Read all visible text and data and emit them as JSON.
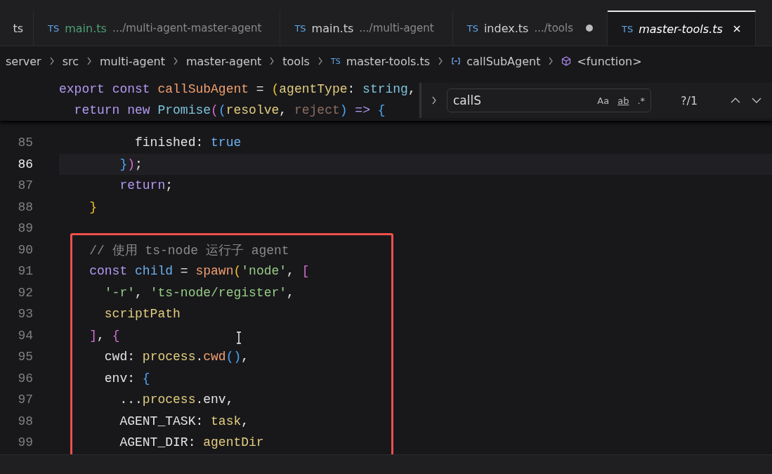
{
  "tabs": [
    {
      "label": "ts",
      "selected": false,
      "modified": false,
      "preview": false,
      "color": "#cfcfcf"
    },
    {
      "icon_text": "TS",
      "label": "main.ts",
      "description": ".../multi-agent-master-agent",
      "selected": false,
      "modified": false,
      "preview": false,
      "color": "#4f9e74"
    },
    {
      "icon_text": "TS",
      "label": "main.ts",
      "description": ".../multi-agent",
      "selected": false,
      "modified": false,
      "preview": false,
      "color": "#cfcfcf"
    },
    {
      "icon_text": "TS",
      "label": "index.ts",
      "description": ".../tools",
      "selected": false,
      "modified": true,
      "preview": false,
      "color": "#cfcfcf"
    },
    {
      "icon_text": "TS",
      "label": "master-tools.ts",
      "selected": true,
      "modified": false,
      "preview": true,
      "color": "#ffffff"
    }
  ],
  "breadcrumb": [
    {
      "kind": "folder",
      "label": "server"
    },
    {
      "kind": "folder",
      "label": "src"
    },
    {
      "kind": "folder",
      "label": "multi-agent"
    },
    {
      "kind": "folder",
      "label": "master-agent"
    },
    {
      "kind": "folder",
      "label": "tools"
    },
    {
      "kind": "file",
      "icon_text": "TS",
      "label": "master-tools.ts"
    },
    {
      "kind": "method",
      "label": "callSubAgent"
    },
    {
      "kind": "function",
      "label": "<function>"
    }
  ],
  "sticky_lines": [
    {
      "tokens": [
        {
          "text": "export ",
          "kind": "kw"
        },
        {
          "text": "const ",
          "kind": "kw"
        },
        {
          "text": "callSubAgent",
          "kind": "fn"
        },
        {
          "text": " = ",
          "kind": "plain"
        },
        {
          "text": "(",
          "kind": "b1"
        },
        {
          "text": "agentType",
          "kind": "param"
        },
        {
          "text": ": ",
          "kind": "plain"
        },
        {
          "text": "string",
          "kind": "type"
        },
        {
          "text": ",",
          "kind": "plain"
        }
      ]
    },
    {
      "tokens": [
        {
          "text": "  return ",
          "kind": "kw"
        },
        {
          "text": "new ",
          "kind": "kw"
        },
        {
          "text": "Promise",
          "kind": "type"
        },
        {
          "text": "(",
          "kind": "b2"
        },
        {
          "text": "(",
          "kind": "b3"
        },
        {
          "text": "resolve",
          "kind": "param"
        },
        {
          "text": ", ",
          "kind": "plain"
        },
        {
          "text": "reject",
          "kind": "unused"
        },
        {
          "text": ")",
          "kind": "b3"
        },
        {
          "text": " => ",
          "kind": "kw"
        },
        {
          "text": "{",
          "kind": "b3"
        }
      ]
    }
  ],
  "find": {
    "value": "callS",
    "options": [
      "Aa",
      "ab",
      ".*"
    ],
    "result": "?/1"
  },
  "lines": [
    {
      "number": "85",
      "current": false,
      "tokens": [
        {
          "text": "          finished",
          "kind": "plain"
        },
        {
          "text": ": ",
          "kind": "plain"
        },
        {
          "text": "true",
          "kind": "const"
        }
      ]
    },
    {
      "number": "86",
      "current": true,
      "tokens": [
        {
          "text": "        }",
          "kind": "b3"
        },
        {
          "text": ")",
          "kind": "b2"
        },
        {
          "text": ";",
          "kind": "plain"
        }
      ]
    },
    {
      "number": "87",
      "current": false,
      "tokens": [
        {
          "text": "        return",
          "kind": "kw"
        },
        {
          "text": ";",
          "kind": "plain"
        }
      ]
    },
    {
      "number": "88",
      "current": false,
      "tokens": [
        {
          "text": "    }",
          "kind": "b1"
        }
      ]
    },
    {
      "number": "89",
      "current": false
    },
    {
      "number": "90",
      "current": false,
      "tokens": [
        {
          "text": "    // 使用 ts-node 运行子 agent",
          "kind": "comment"
        }
      ]
    },
    {
      "number": "91",
      "current": false,
      "tokens": [
        {
          "text": "    const ",
          "kind": "kw"
        },
        {
          "text": "child",
          "kind": "const"
        },
        {
          "text": " = ",
          "kind": "plain"
        },
        {
          "text": "spawn",
          "kind": "fn"
        },
        {
          "text": "(",
          "kind": "b1"
        },
        {
          "text": "'node'",
          "kind": "str"
        },
        {
          "text": ", ",
          "kind": "plain"
        },
        {
          "text": "[",
          "kind": "b2"
        }
      ]
    },
    {
      "number": "92",
      "current": false,
      "tokens": [
        {
          "text": "      '-r'",
          "kind": "str"
        },
        {
          "text": ", ",
          "kind": "plain"
        },
        {
          "text": "'ts-node/register'",
          "kind": "str"
        },
        {
          "text": ",",
          "kind": "plain"
        }
      ]
    },
    {
      "number": "93",
      "current": false,
      "tokens": [
        {
          "text": "      scriptPath",
          "kind": "param"
        }
      ]
    },
    {
      "number": "94",
      "current": false,
      "tokens": [
        {
          "text": "    ]",
          "kind": "b2"
        },
        {
          "text": ", ",
          "kind": "plain"
        },
        {
          "text": "{",
          "kind": "b2"
        }
      ]
    },
    {
      "number": "95",
      "current": false,
      "tokens": [
        {
          "text": "      cwd: ",
          "kind": "plain"
        },
        {
          "text": "process",
          "kind": "param"
        },
        {
          "text": ".",
          "kind": "plain"
        },
        {
          "text": "cwd",
          "kind": "fn"
        },
        {
          "text": "()",
          "kind": "b3"
        },
        {
          "text": ",",
          "kind": "plain"
        }
      ]
    },
    {
      "number": "96",
      "current": false,
      "tokens": [
        {
          "text": "      env: ",
          "kind": "plain"
        },
        {
          "text": "{",
          "kind": "b3"
        }
      ]
    },
    {
      "number": "97",
      "current": false,
      "tokens": [
        {
          "text": "        ...",
          "kind": "plain"
        },
        {
          "text": "process",
          "kind": "param"
        },
        {
          "text": ".env,",
          "kind": "plain"
        }
      ]
    },
    {
      "number": "98",
      "current": false,
      "tokens": [
        {
          "text": "        AGENT_TASK: ",
          "kind": "plain"
        },
        {
          "text": "task",
          "kind": "param"
        },
        {
          "text": ",",
          "kind": "plain"
        }
      ]
    },
    {
      "number": "99",
      "current": false,
      "tokens": [
        {
          "text": "        AGENT_DIR: ",
          "kind": "plain"
        },
        {
          "text": "agentDir",
          "kind": "param"
        }
      ]
    }
  ]
}
